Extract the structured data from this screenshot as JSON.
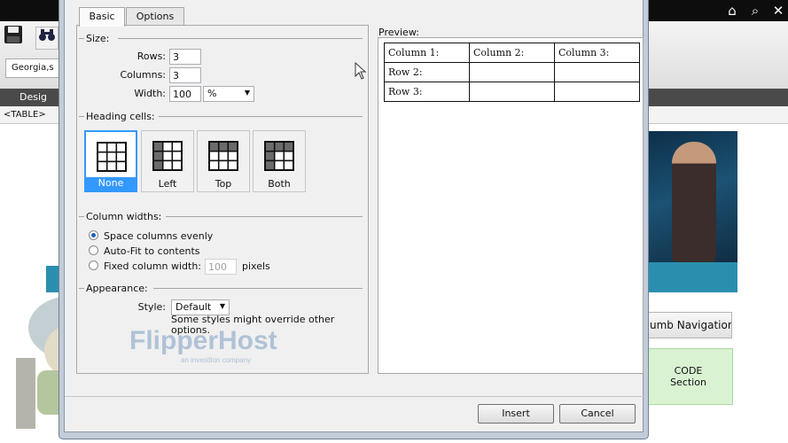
{
  "background": {
    "top_icons": [
      "home-icon",
      "search-icon",
      "close-icon"
    ],
    "font_value": "Georgia,s",
    "design_tab_label": "Desig",
    "tag_path": "<TABLE>",
    "breadcrumb_button_label": "umb Navigation",
    "code_box": {
      "line1": "CODE",
      "line2": "Section"
    },
    "watermark": {
      "brand": "FlipperHost",
      "tagline": "an investlion company"
    }
  },
  "dialog": {
    "tabs": [
      {
        "label": "Basic",
        "active": true
      },
      {
        "label": "Options",
        "active": false
      }
    ],
    "size": {
      "title": "Size:",
      "rows_label": "Rows:",
      "rows_value": "3",
      "columns_label": "Columns:",
      "columns_value": "3",
      "width_label": "Width:",
      "width_value": "100",
      "width_unit": "%"
    },
    "heading_cells": {
      "title": "Heading cells:",
      "options": [
        {
          "label": "None",
          "selected": true,
          "icon": "table-none-icon"
        },
        {
          "label": "Left",
          "selected": false,
          "icon": "table-left-heading-icon"
        },
        {
          "label": "Top",
          "selected": false,
          "icon": "table-top-heading-icon"
        },
        {
          "label": "Both",
          "selected": false,
          "icon": "table-both-heading-icon"
        }
      ]
    },
    "column_widths": {
      "title": "Column widths:",
      "options": [
        {
          "label": "Space columns evenly",
          "selected": true
        },
        {
          "label": "Auto-Fit to contents",
          "selected": false
        },
        {
          "label": "Fixed column width:",
          "selected": false
        }
      ],
      "fixed_width_value": "100",
      "fixed_width_unit": "pixels"
    },
    "appearance": {
      "title": "Appearance:",
      "style_label": "Style:",
      "style_value": "Default",
      "note": "Some styles might override other options."
    },
    "preview": {
      "label": "Preview:",
      "rows": [
        [
          "Column 1:",
          "Column 2:",
          "Column 3:"
        ],
        [
          "Row 2:",
          "",
          ""
        ],
        [
          "Row 3:",
          "",
          ""
        ]
      ]
    },
    "buttons": {
      "insert": "Insert",
      "cancel": "Cancel"
    }
  }
}
